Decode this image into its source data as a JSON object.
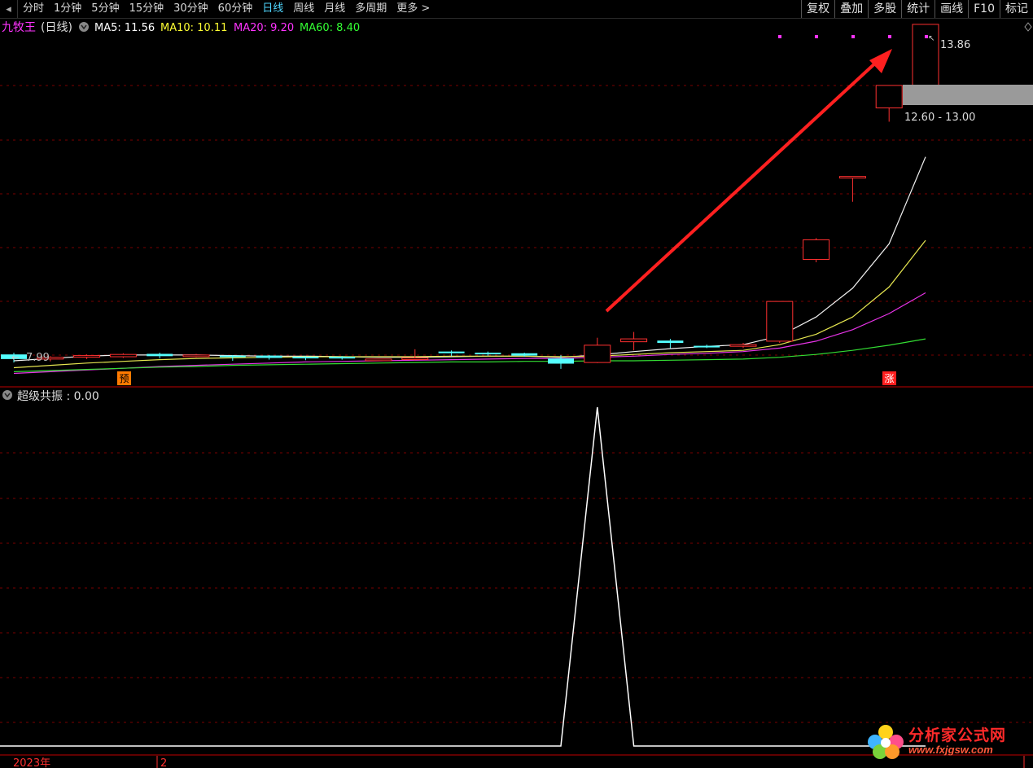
{
  "toolbar": {
    "back_icon": "◂",
    "periods": [
      {
        "label": "分时",
        "active": false
      },
      {
        "label": "1分钟",
        "active": false
      },
      {
        "label": "5分钟",
        "active": false
      },
      {
        "label": "15分钟",
        "active": false
      },
      {
        "label": "30分钟",
        "active": false
      },
      {
        "label": "60分钟",
        "active": false
      },
      {
        "label": "日线",
        "active": true
      },
      {
        "label": "周线",
        "active": false
      },
      {
        "label": "月线",
        "active": false
      },
      {
        "label": "多周期",
        "active": false
      },
      {
        "label": "更多 >",
        "active": false
      }
    ],
    "right_buttons": [
      "复权",
      "叠加",
      "多股",
      "统计",
      "画线",
      "F10",
      "标记"
    ]
  },
  "main_panel": {
    "indicator_name": "九牧王",
    "period_label": "(日线)",
    "ma_legend": [
      {
        "label": "MA5: 11.56",
        "color": "#ffffff"
      },
      {
        "label": "MA10: 10.11",
        "color": "#ffff33"
      },
      {
        "label": "MA20: 9.20",
        "color": "#ff33ff"
      },
      {
        "label": "MA60: 8.40",
        "color": "#33ff33"
      }
    ],
    "high_label": "13.86",
    "low_label": "7.99",
    "range_label": "12.60 - 13.00",
    "marker_pre": "预",
    "marker_zhang": "涨"
  },
  "sub_panel": {
    "indicator_label": "超级共振 : 0.00"
  },
  "axis": {
    "year_label": "2023年",
    "month_label": "2"
  },
  "watermark": {
    "name": "分析家公式网",
    "url": "www.fxjgsw.com"
  },
  "colors": {
    "up": "#ff3030",
    "down": "#54ffff",
    "arrow": "#ff2020",
    "grid": "#7a0000"
  },
  "chart_data": [
    {
      "type": "candlestick",
      "title": "",
      "x": [
        1,
        2,
        3,
        4,
        5,
        6,
        7,
        8,
        9,
        10,
        11,
        12,
        13,
        14,
        15,
        16,
        17,
        18,
        19,
        20,
        21,
        22,
        23,
        24,
        25
      ],
      "ohlc": [
        {
          "o": 8.13,
          "h": 8.16,
          "l": 7.99,
          "c": 8.05
        },
        {
          "o": 8.05,
          "h": 8.1,
          "l": 8.01,
          "c": 8.08
        },
        {
          "o": 8.09,
          "h": 8.13,
          "l": 8.05,
          "c": 8.11
        },
        {
          "o": 8.09,
          "h": 8.15,
          "l": 8.07,
          "c": 8.13
        },
        {
          "o": 8.14,
          "h": 8.16,
          "l": 8.06,
          "c": 8.1
        },
        {
          "o": 8.1,
          "h": 8.14,
          "l": 8.08,
          "c": 8.12
        },
        {
          "o": 8.11,
          "h": 8.12,
          "l": 8.02,
          "c": 8.1
        },
        {
          "o": 8.11,
          "h": 8.12,
          "l": 8.04,
          "c": 8.07
        },
        {
          "o": 8.09,
          "h": 8.1,
          "l": 8.03,
          "c": 8.08
        },
        {
          "o": 8.09,
          "h": 8.1,
          "l": 8.04,
          "c": 8.06
        },
        {
          "o": 8.04,
          "h": 8.05,
          "l": 8.02,
          "c": 8.05
        },
        {
          "o": 8.06,
          "h": 8.22,
          "l": 8.03,
          "c": 8.07
        },
        {
          "o": 8.18,
          "h": 8.2,
          "l": 8.1,
          "c": 8.16
        },
        {
          "o": 8.16,
          "h": 8.18,
          "l": 8.11,
          "c": 8.15
        },
        {
          "o": 8.15,
          "h": 8.16,
          "l": 8.09,
          "c": 8.11
        },
        {
          "o": 8.06,
          "h": 8.12,
          "l": 7.88,
          "c": 7.97
        },
        {
          "o": 7.99,
          "h": 8.42,
          "l": 7.98,
          "c": 8.29
        },
        {
          "o": 8.35,
          "h": 8.52,
          "l": 8.2,
          "c": 8.4
        },
        {
          "o": 8.37,
          "h": 8.4,
          "l": 8.24,
          "c": 8.33
        },
        {
          "o": 8.28,
          "h": 8.3,
          "l": 8.24,
          "c": 8.26
        },
        {
          "o": 8.28,
          "h": 8.33,
          "l": 8.24,
          "c": 8.3
        },
        {
          "o": 8.36,
          "h": 8.62,
          "l": 8.33,
          "c": 9.05
        },
        {
          "o": 9.78,
          "h": 10.15,
          "l": 9.73,
          "c": 10.12
        },
        {
          "o": 11.22,
          "h": 11.22,
          "l": 10.78,
          "c": 11.22
        },
        {
          "o": 12.41,
          "h": 12.8,
          "l": 12.17,
          "c": 12.8
        },
        {
          "o": 12.8,
          "h": 13.86,
          "l": 12.8,
          "c": 13.86
        }
      ],
      "ma": {
        "MA5": [
          8.02,
          8.06,
          8.1,
          8.12,
          8.12,
          8.12,
          8.11,
          8.1,
          8.1,
          8.09,
          8.08,
          8.08,
          8.09,
          8.1,
          8.1,
          8.08,
          8.12,
          8.18,
          8.23,
          8.27,
          8.3,
          8.45,
          8.78,
          9.28,
          10.05,
          11.56
        ],
        "MA10": [
          7.9,
          7.94,
          7.98,
          8.01,
          8.04,
          8.06,
          8.07,
          8.08,
          8.09,
          8.09,
          8.09,
          8.09,
          8.1,
          8.1,
          8.1,
          8.09,
          8.1,
          8.13,
          8.16,
          8.18,
          8.2,
          8.3,
          8.48,
          8.78,
          9.3,
          10.11
        ],
        "MA20": [
          7.8,
          7.83,
          7.86,
          7.89,
          7.92,
          7.94,
          7.96,
          7.98,
          8.0,
          8.01,
          8.02,
          8.03,
          8.04,
          8.05,
          8.06,
          8.06,
          8.08,
          8.1,
          8.13,
          8.15,
          8.18,
          8.24,
          8.36,
          8.56,
          8.84,
          9.2
        ],
        "MA60": [
          7.83,
          7.85,
          7.87,
          7.89,
          7.91,
          7.92,
          7.94,
          7.95,
          7.96,
          7.97,
          7.98,
          7.99,
          8.0,
          8.0,
          8.01,
          8.01,
          8.02,
          8.02,
          8.03,
          8.04,
          8.05,
          8.08,
          8.13,
          8.2,
          8.29,
          8.4
        ]
      },
      "ylim": [
        7.85,
        14.0
      ],
      "annotations": [
        "13.86",
        "7.99",
        "12.60 - 13.00",
        "预",
        "涨"
      ]
    },
    {
      "type": "line",
      "title": "",
      "series": [
        {
          "values": [
            0,
            0,
            0,
            0,
            0,
            0,
            0,
            0,
            0,
            0,
            0,
            0,
            0,
            0,
            0,
            0,
            1,
            0,
            0,
            0,
            0,
            0,
            0,
            0,
            0,
            0
          ]
        }
      ],
      "ylim": [
        0,
        1
      ]
    }
  ]
}
